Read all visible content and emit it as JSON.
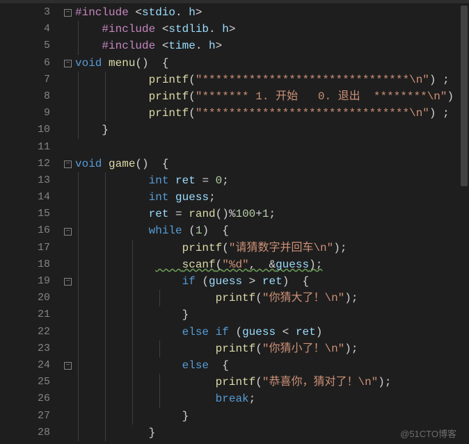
{
  "watermark": "@51CTO博客",
  "lines": [
    {
      "n": "3",
      "fold": "-",
      "indent": 0,
      "tok": [
        [
          "dir",
          "#include"
        ],
        [
          "op",
          " <"
        ],
        [
          "var",
          "stdio"
        ],
        [
          "op",
          ". "
        ],
        [
          "var",
          "h"
        ],
        [
          "op",
          ">"
        ]
      ]
    },
    {
      "n": "4",
      "indent": 1,
      "tok": [
        [
          "dir",
          "#include"
        ],
        [
          "op",
          " <"
        ],
        [
          "var",
          "stdlib"
        ],
        [
          "op",
          ". "
        ],
        [
          "var",
          "h"
        ],
        [
          "op",
          ">"
        ]
      ]
    },
    {
      "n": "5",
      "indent": 1,
      "tok": [
        [
          "dir",
          "#include"
        ],
        [
          "op",
          " <"
        ],
        [
          "var",
          "time"
        ],
        [
          "op",
          ". "
        ],
        [
          "var",
          "h"
        ],
        [
          "op",
          ">"
        ]
      ]
    },
    {
      "n": "6",
      "fold": "-",
      "indent": 0,
      "tok": [
        [
          "kw",
          "void"
        ],
        [
          "op",
          " "
        ],
        [
          "fn",
          "menu"
        ],
        [
          "pn",
          "()"
        ],
        [
          "op",
          "  "
        ],
        [
          "pn",
          "{"
        ]
      ]
    },
    {
      "n": "7",
      "indent": 2,
      "tok": [
        [
          "op",
          "   "
        ],
        [
          "fn",
          "printf"
        ],
        [
          "pn",
          "("
        ],
        [
          "str",
          "\"*******************************\\n\""
        ],
        [
          "pn",
          ")"
        ],
        [
          "op",
          " ;"
        ]
      ]
    },
    {
      "n": "8",
      "indent": 2,
      "tok": [
        [
          "op",
          "   "
        ],
        [
          "fn",
          "printf"
        ],
        [
          "pn",
          "("
        ],
        [
          "str",
          "\"******* 1. 开始   0. 退出  ********\\n\""
        ],
        [
          "pn",
          ")"
        ],
        [
          "op",
          " ;"
        ]
      ]
    },
    {
      "n": "9",
      "indent": 2,
      "tok": [
        [
          "op",
          "   "
        ],
        [
          "fn",
          "printf"
        ],
        [
          "pn",
          "("
        ],
        [
          "str",
          "\"*******************************\\n\""
        ],
        [
          "pn",
          ")"
        ],
        [
          "op",
          " ;"
        ]
      ]
    },
    {
      "n": "10",
      "indent": 1,
      "tok": [
        [
          "pn",
          "}"
        ]
      ]
    },
    {
      "n": "11",
      "indent": 0,
      "tok": []
    },
    {
      "n": "12",
      "fold": "-",
      "indent": 0,
      "tok": [
        [
          "kw",
          "void"
        ],
        [
          "op",
          " "
        ],
        [
          "fn",
          "game"
        ],
        [
          "pn",
          "()"
        ],
        [
          "op",
          "  "
        ],
        [
          "pn",
          "{"
        ]
      ]
    },
    {
      "n": "13",
      "indent": 2,
      "tok": [
        [
          "op",
          "   "
        ],
        [
          "kw",
          "int"
        ],
        [
          "op",
          " "
        ],
        [
          "var",
          "ret"
        ],
        [
          "op",
          " = "
        ],
        [
          "num",
          "0"
        ],
        [
          "op",
          ";"
        ]
      ]
    },
    {
      "n": "14",
      "indent": 2,
      "tok": [
        [
          "op",
          "   "
        ],
        [
          "kw",
          "int"
        ],
        [
          "op",
          " "
        ],
        [
          "var",
          "guess"
        ],
        [
          "op",
          ";"
        ]
      ]
    },
    {
      "n": "15",
      "indent": 2,
      "tok": [
        [
          "op",
          "   "
        ],
        [
          "var",
          "ret"
        ],
        [
          "op",
          " = "
        ],
        [
          "fn",
          "rand"
        ],
        [
          "pn",
          "()"
        ],
        [
          "op",
          "%"
        ],
        [
          "num",
          "100"
        ],
        [
          "op",
          "+"
        ],
        [
          "num",
          "1"
        ],
        [
          "op",
          ";"
        ]
      ]
    },
    {
      "n": "16",
      "fold": "-",
      "indent": 2,
      "tok": [
        [
          "op",
          "   "
        ],
        [
          "kw",
          "while"
        ],
        [
          "op",
          " "
        ],
        [
          "pn",
          "("
        ],
        [
          "num",
          "1"
        ],
        [
          "pn",
          ")"
        ],
        [
          "op",
          "  "
        ],
        [
          "pn",
          "{"
        ]
      ]
    },
    {
      "n": "17",
      "indent": 3,
      "tok": [
        [
          "op",
          "    "
        ],
        [
          "fn",
          "printf"
        ],
        [
          "pn",
          "("
        ],
        [
          "str",
          "\"请猜数字并回车\\n\""
        ],
        [
          "pn",
          ")"
        ],
        [
          "op",
          ";"
        ]
      ]
    },
    {
      "n": "18",
      "indent": 3,
      "wavy": true,
      "tok": [
        [
          "op",
          "    "
        ],
        [
          "fn",
          "scanf"
        ],
        [
          "pn",
          "("
        ],
        [
          "str",
          "\"%d\""
        ],
        [
          "op",
          ",  &"
        ],
        [
          "var",
          "guess"
        ],
        [
          "pn",
          ")"
        ],
        [
          "op",
          ";"
        ]
      ]
    },
    {
      "n": "19",
      "fold": "-",
      "indent": 3,
      "tok": [
        [
          "op",
          "    "
        ],
        [
          "kw",
          "if"
        ],
        [
          "op",
          " "
        ],
        [
          "pn",
          "("
        ],
        [
          "var",
          "guess"
        ],
        [
          "op",
          " > "
        ],
        [
          "var",
          "ret"
        ],
        [
          "pn",
          ")"
        ],
        [
          "op",
          "  "
        ],
        [
          "pn",
          "{"
        ]
      ]
    },
    {
      "n": "20",
      "indent": 4,
      "tok": [
        [
          "op",
          "     "
        ],
        [
          "fn",
          "printf"
        ],
        [
          "pn",
          "("
        ],
        [
          "str",
          "\"你猜大了！\\n\""
        ],
        [
          "pn",
          ")"
        ],
        [
          "op",
          ";"
        ]
      ]
    },
    {
      "n": "21",
      "indent": 3,
      "tok": [
        [
          "op",
          "    "
        ],
        [
          "pn",
          "}"
        ]
      ]
    },
    {
      "n": "22",
      "indent": 3,
      "tok": [
        [
          "op",
          "    "
        ],
        [
          "kw",
          "else"
        ],
        [
          "op",
          " "
        ],
        [
          "kw",
          "if"
        ],
        [
          "op",
          " "
        ],
        [
          "pn",
          "("
        ],
        [
          "var",
          "guess"
        ],
        [
          "op",
          " < "
        ],
        [
          "var",
          "ret"
        ],
        [
          "pn",
          ")"
        ]
      ]
    },
    {
      "n": "23",
      "indent": 4,
      "tok": [
        [
          "op",
          "     "
        ],
        [
          "fn",
          "printf"
        ],
        [
          "pn",
          "("
        ],
        [
          "str",
          "\"你猜小了！\\n\""
        ],
        [
          "pn",
          ")"
        ],
        [
          "op",
          ";"
        ]
      ]
    },
    {
      "n": "24",
      "fold": "-",
      "indent": 3,
      "tok": [
        [
          "op",
          "    "
        ],
        [
          "kw",
          "else"
        ],
        [
          "op",
          "  "
        ],
        [
          "pn",
          "{"
        ]
      ]
    },
    {
      "n": "25",
      "indent": 4,
      "tok": [
        [
          "op",
          "     "
        ],
        [
          "fn",
          "printf"
        ],
        [
          "pn",
          "("
        ],
        [
          "str",
          "\"恭喜你，猜对了！\\n\""
        ],
        [
          "pn",
          ")"
        ],
        [
          "op",
          ";"
        ]
      ]
    },
    {
      "n": "26",
      "indent": 4,
      "tok": [
        [
          "op",
          "     "
        ],
        [
          "kw",
          "break"
        ],
        [
          "op",
          ";"
        ]
      ]
    },
    {
      "n": "27",
      "indent": 3,
      "tok": [
        [
          "op",
          "    "
        ],
        [
          "pn",
          "}"
        ]
      ]
    },
    {
      "n": "28",
      "indent": 2,
      "tok": [
        [
          "op",
          "   "
        ],
        [
          "pn",
          "}"
        ]
      ]
    }
  ]
}
